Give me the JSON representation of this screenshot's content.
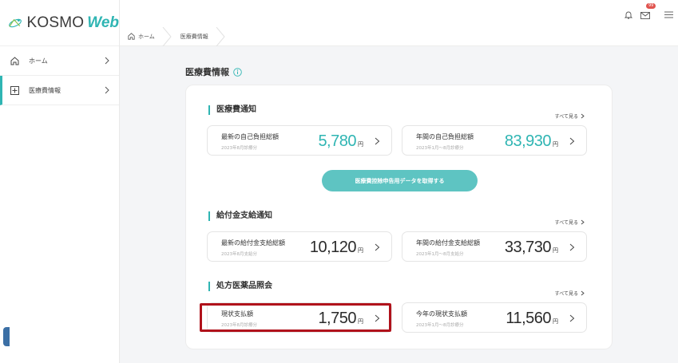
{
  "app": {
    "logo_text": "KOSMO",
    "logo_web": "Web"
  },
  "sidebar": {
    "items": [
      {
        "label": "ホーム",
        "icon": "home-icon"
      },
      {
        "label": "医療費情報",
        "icon": "plus-square-icon"
      }
    ]
  },
  "header": {
    "notification_badge": "99"
  },
  "breadcrumb": [
    "ホーム",
    "医療費情報"
  ],
  "page": {
    "title": "医療費情報"
  },
  "sections": [
    {
      "title": "医療費通知",
      "see_all": "すべて見る",
      "tiles": [
        {
          "label": "最新の自己負担総額",
          "sub": "2023年8月診療分",
          "value": "5,780",
          "unit": "円"
        },
        {
          "label": "年間の自己負担総額",
          "sub": "2023年1月～8月診療分",
          "value": "83,930",
          "unit": "円"
        }
      ],
      "cta": "医療費控除申告用データを取得する"
    },
    {
      "title": "給付金支給通知",
      "see_all": "すべて見る",
      "tiles": [
        {
          "label": "最新の給付金支給総額",
          "sub": "2023年8月支給分",
          "value": "10,120",
          "unit": "円"
        },
        {
          "label": "年間の給付金支給総額",
          "sub": "2023年1月～8月支給分",
          "value": "33,730",
          "unit": "円"
        }
      ]
    },
    {
      "title": "処方医薬品照会",
      "see_all": "すべて見る",
      "tiles": [
        {
          "label": "現状支払額",
          "sub": "2023年8月診療分",
          "value": "1,750",
          "unit": "円"
        },
        {
          "label": "今年の現状支払額",
          "sub": "2023年1月～8月診療分",
          "value": "11,560",
          "unit": "円"
        }
      ]
    }
  ],
  "colors": {
    "accent": "#2fb5b3",
    "highlight": "#b0121b"
  }
}
